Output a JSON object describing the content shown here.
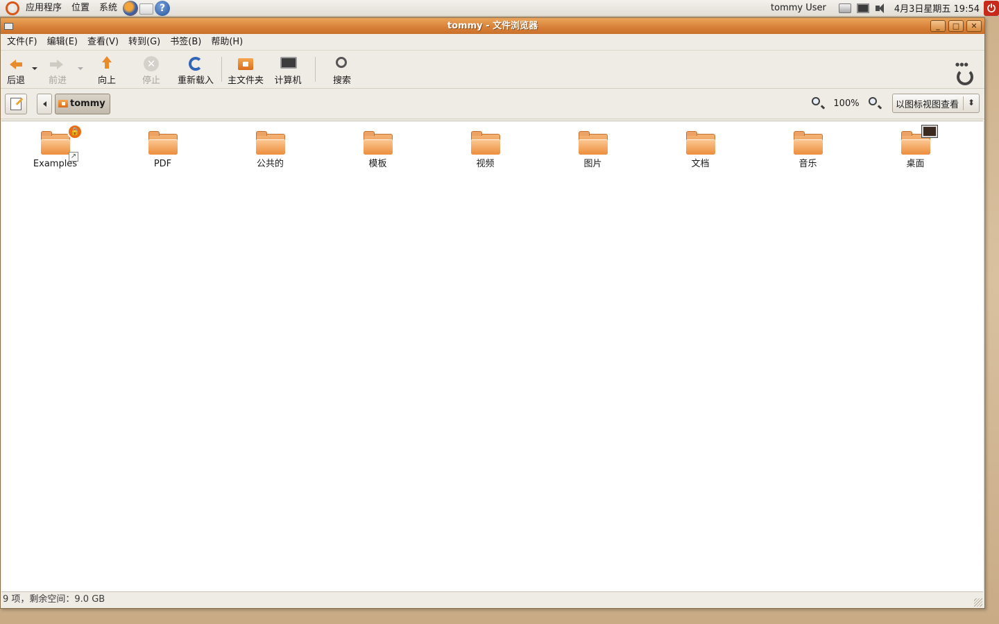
{
  "panel": {
    "menus": [
      "应用程序",
      "位置",
      "系统"
    ],
    "user": "tommy User",
    "clock": "4月3日星期五  19:54"
  },
  "window": {
    "title": "tommy - 文件浏览器"
  },
  "menubar": [
    "文件(F)",
    "编辑(E)",
    "查看(V)",
    "转到(G)",
    "书签(B)",
    "帮助(H)"
  ],
  "toolbar": {
    "back": "后退",
    "forward": "前进",
    "up": "向上",
    "stop": "停止",
    "reload": "重新载入",
    "home": "主文件夹",
    "computer": "计算机",
    "search": "搜索"
  },
  "location": {
    "current": "tommy",
    "zoom": "100%",
    "view_mode": "以图标视图查看"
  },
  "items": [
    {
      "label": "Examples",
      "emblem": "lock-and-link"
    },
    {
      "label": "PDF"
    },
    {
      "label": "公共的"
    },
    {
      "label": "模板"
    },
    {
      "label": "视频"
    },
    {
      "label": "图片"
    },
    {
      "label": "文档"
    },
    {
      "label": "音乐"
    },
    {
      "label": "桌面",
      "emblem": "desktop"
    }
  ],
  "status": "9 项，剩余空间：9.0 GB",
  "colors": {
    "titlebar": "#d9823a",
    "folder": "#ec8d3c",
    "accent": "#e98a2b"
  }
}
